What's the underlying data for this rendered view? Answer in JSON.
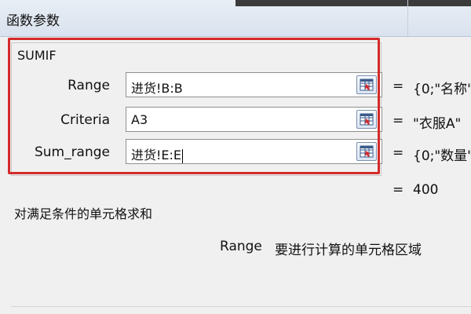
{
  "window": {
    "title": "函数参数"
  },
  "function": {
    "name": "SUMIF"
  },
  "arguments": [
    {
      "label": "Range",
      "value": "进货!B:B",
      "result": "{0;\"名称\""
    },
    {
      "label": "Criteria",
      "value": "A3",
      "result": "\"衣服A\""
    },
    {
      "label": "Sum_range",
      "value": "进货!E:E",
      "result": "{0;\"数量\""
    }
  ],
  "formula_result": "400",
  "equals_sign": "=",
  "description": "对满足条件的单元格求和",
  "argument_help": {
    "name": "Range",
    "text": "要进行计算的单元格区域"
  },
  "icons": {
    "collapse": "range-select-icon"
  },
  "colors": {
    "highlight": "#d42a2a"
  }
}
